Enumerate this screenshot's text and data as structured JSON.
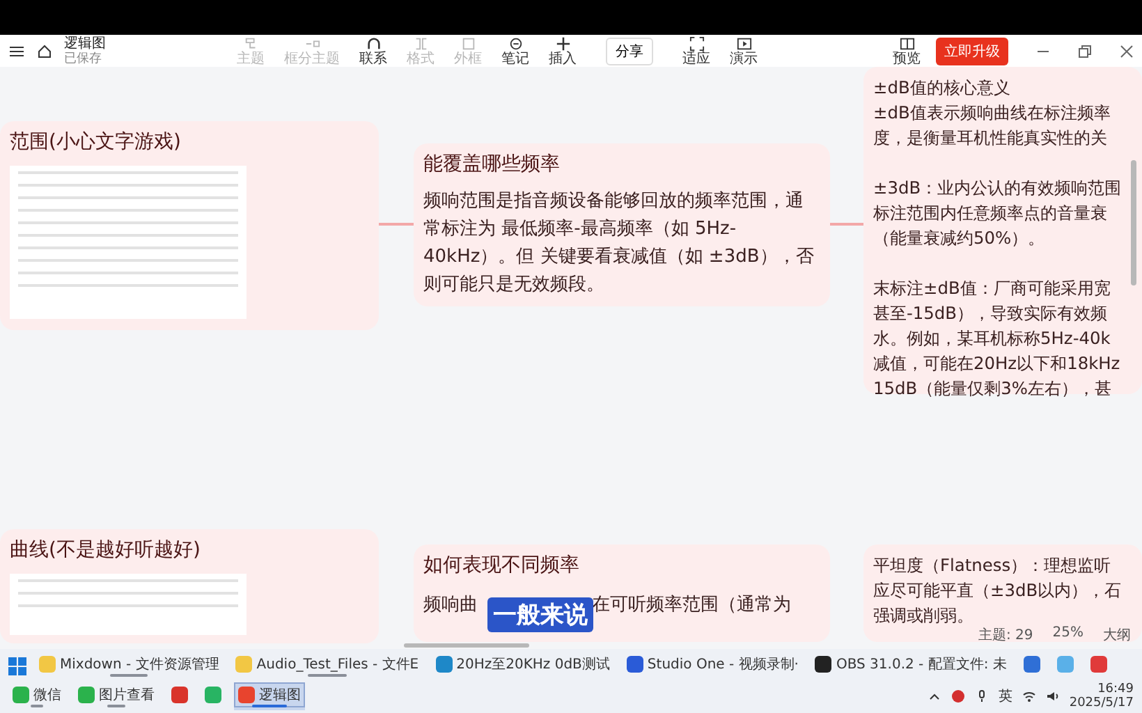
{
  "window": {
    "title": "逻辑图",
    "status": "已保存"
  },
  "toolbar": {
    "tools": [
      {
        "label": "主题",
        "disabled": true
      },
      {
        "label": "框分主题",
        "disabled": true
      },
      {
        "label": "联系",
        "disabled": false
      },
      {
        "label": "格式",
        "disabled": true
      },
      {
        "label": "外框",
        "disabled": true
      },
      {
        "label": "笔记",
        "disabled": false
      },
      {
        "label": "插入",
        "disabled": false
      }
    ],
    "share": "分享",
    "views": [
      "适应",
      "演示"
    ],
    "preview": "预览",
    "upgrade": "立即升级"
  },
  "canvas": {
    "nodes": [
      {
        "kind": "image",
        "title": "范围(小心文字游戏)"
      },
      {
        "kind": "text",
        "title": "能覆盖哪些频率",
        "paragraph": "频响范围是指音频设备能够回放的频率范围，通常标注为 最低频率-最高频率（如 5Hz-40kHz）。但 关键要看衰减值（如 ±3dB），否则可能只是无效频段。"
      },
      {
        "kind": "lines",
        "paragraphs": [
          [
            "±dB值的核心意义",
            "±dB值表示频响曲线在标注频率",
            "度，是衡量耳机性能真实性的关"
          ],
          [
            "±3dB：业内公认的有效频响范围",
            "标注范围内任意频率点的音量衰",
            "（能量衰减约50%）。"
          ],
          [
            "末标注±dB值：厂商可能采用宽",
            "甚至-15dB），导致实际有效频",
            "水。例如，某耳机标称5Hz-40k",
            "减值，可能在20Hz以下和18kHz",
            "15dB（能量仅剩3%左右），甚"
          ]
        ]
      },
      {
        "kind": "image",
        "title": "曲线(不是越好听越好)"
      },
      {
        "kind": "split",
        "title": "如何表现不同频率",
        "before": "频响曲",
        "after": "在可听频率范围（通常为"
      },
      {
        "kind": "lines",
        "paragraphs": [
          [
            "平坦度（Flatness）：理想监听",
            "应尽可能平直（±3dB以内），石",
            "强调或削弱。"
          ]
        ]
      }
    ],
    "subtitle": "一般来说",
    "status": {
      "topics": "主题: 29",
      "zoom": "25%",
      "outline": "大纲"
    }
  },
  "taskbar": {
    "apps": [
      {
        "kind": "labeled",
        "label": "Mixdown - 文件资源管理",
        "color": "#f2c744",
        "running": true,
        "selected": false
      },
      {
        "kind": "labeled",
        "label": "Audio_Test_Files - 文件E",
        "color": "#f2c744",
        "running": true,
        "selected": false
      },
      {
        "kind": "labeled",
        "label": "20Hz至20KHz 0dB测试",
        "color": "#1e88c8",
        "running": false,
        "selected": false
      },
      {
        "kind": "labeled",
        "label": "Studio One - 视频录制·",
        "color": "#2a5bd7",
        "running": false,
        "selected": false
      },
      {
        "kind": "labeled",
        "label": "OBS 31.0.2 - 配置文件: 未",
        "color": "#222222",
        "running": false,
        "selected": false
      },
      {
        "kind": "icon",
        "color": "#2f6fd6",
        "running": false,
        "selected": false
      },
      {
        "kind": "icon",
        "color": "#5ab0e8",
        "running": false,
        "selected": false
      },
      {
        "kind": "icon",
        "color": "#e03a3a",
        "running": false,
        "selected": false
      },
      {
        "kind": "labeled",
        "label": "微信",
        "color": "#2bb24c",
        "running": true,
        "selected": false
      },
      {
        "kind": "labeled",
        "label": "图片查看",
        "color": "#2bb24c",
        "running": true,
        "selected": false
      },
      {
        "kind": "icon",
        "color": "#d9342b",
        "running": false,
        "selected": false
      },
      {
        "kind": "icon",
        "color": "#28b463",
        "running": false,
        "selected": false
      },
      {
        "kind": "labeled",
        "label": "逻辑图",
        "color": "#e8442e",
        "running": true,
        "selected": true
      }
    ],
    "tray": {
      "ime": "英",
      "time": "16:49",
      "date": "2025/5/17"
    }
  }
}
